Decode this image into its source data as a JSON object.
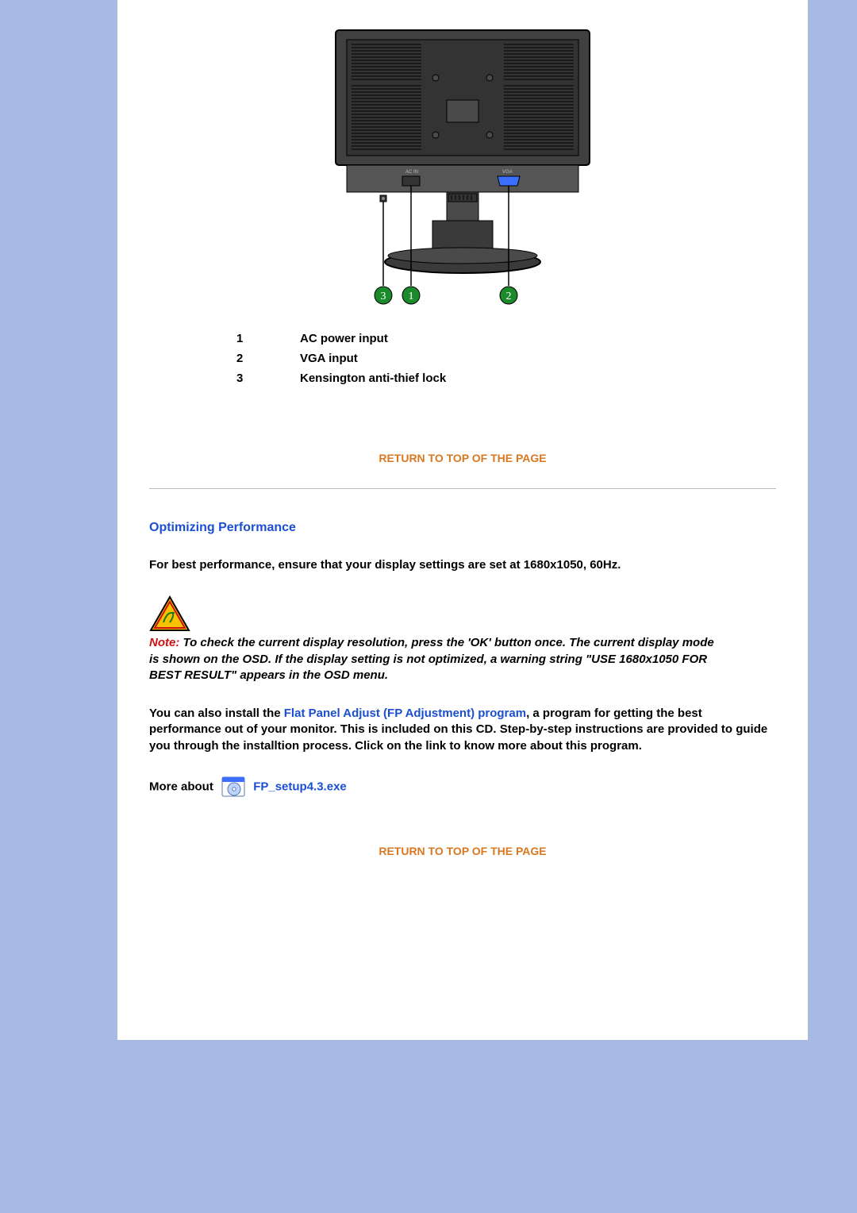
{
  "legend": [
    {
      "num": "1",
      "label": "AC power input"
    },
    {
      "num": "2",
      "label": "VGA input"
    },
    {
      "num": "3",
      "label": "Kensington anti-thief lock"
    }
  ],
  "callouts": {
    "c1": "1",
    "c2": "2",
    "c3": "3"
  },
  "return_link": "RETURN TO TOP OF THE PAGE",
  "section_title": "Optimizing Performance",
  "perf_line": "For best performance, ensure that your display settings are set at 1680x1050, 60Hz.",
  "note_label": "Note:",
  "note_body": " To check the current display resolution, press the 'OK' button once. The current display mode is shown on the OSD. If the display setting is not optimized, a warning string \"USE 1680x1050 FOR BEST RESULT\" appears in the OSD menu.",
  "install_pre": "You can also install the ",
  "install_link": "Flat Panel Adjust (FP Adjustment) program",
  "install_post": ", a program for getting the best performance out of your monitor. This is included on this CD. Step-by-step instructions are provided to guide you through the installtion process. Click on the link to know more about this program.",
  "more_about": "More about",
  "fp_exe": "FP_setup4.3.exe"
}
